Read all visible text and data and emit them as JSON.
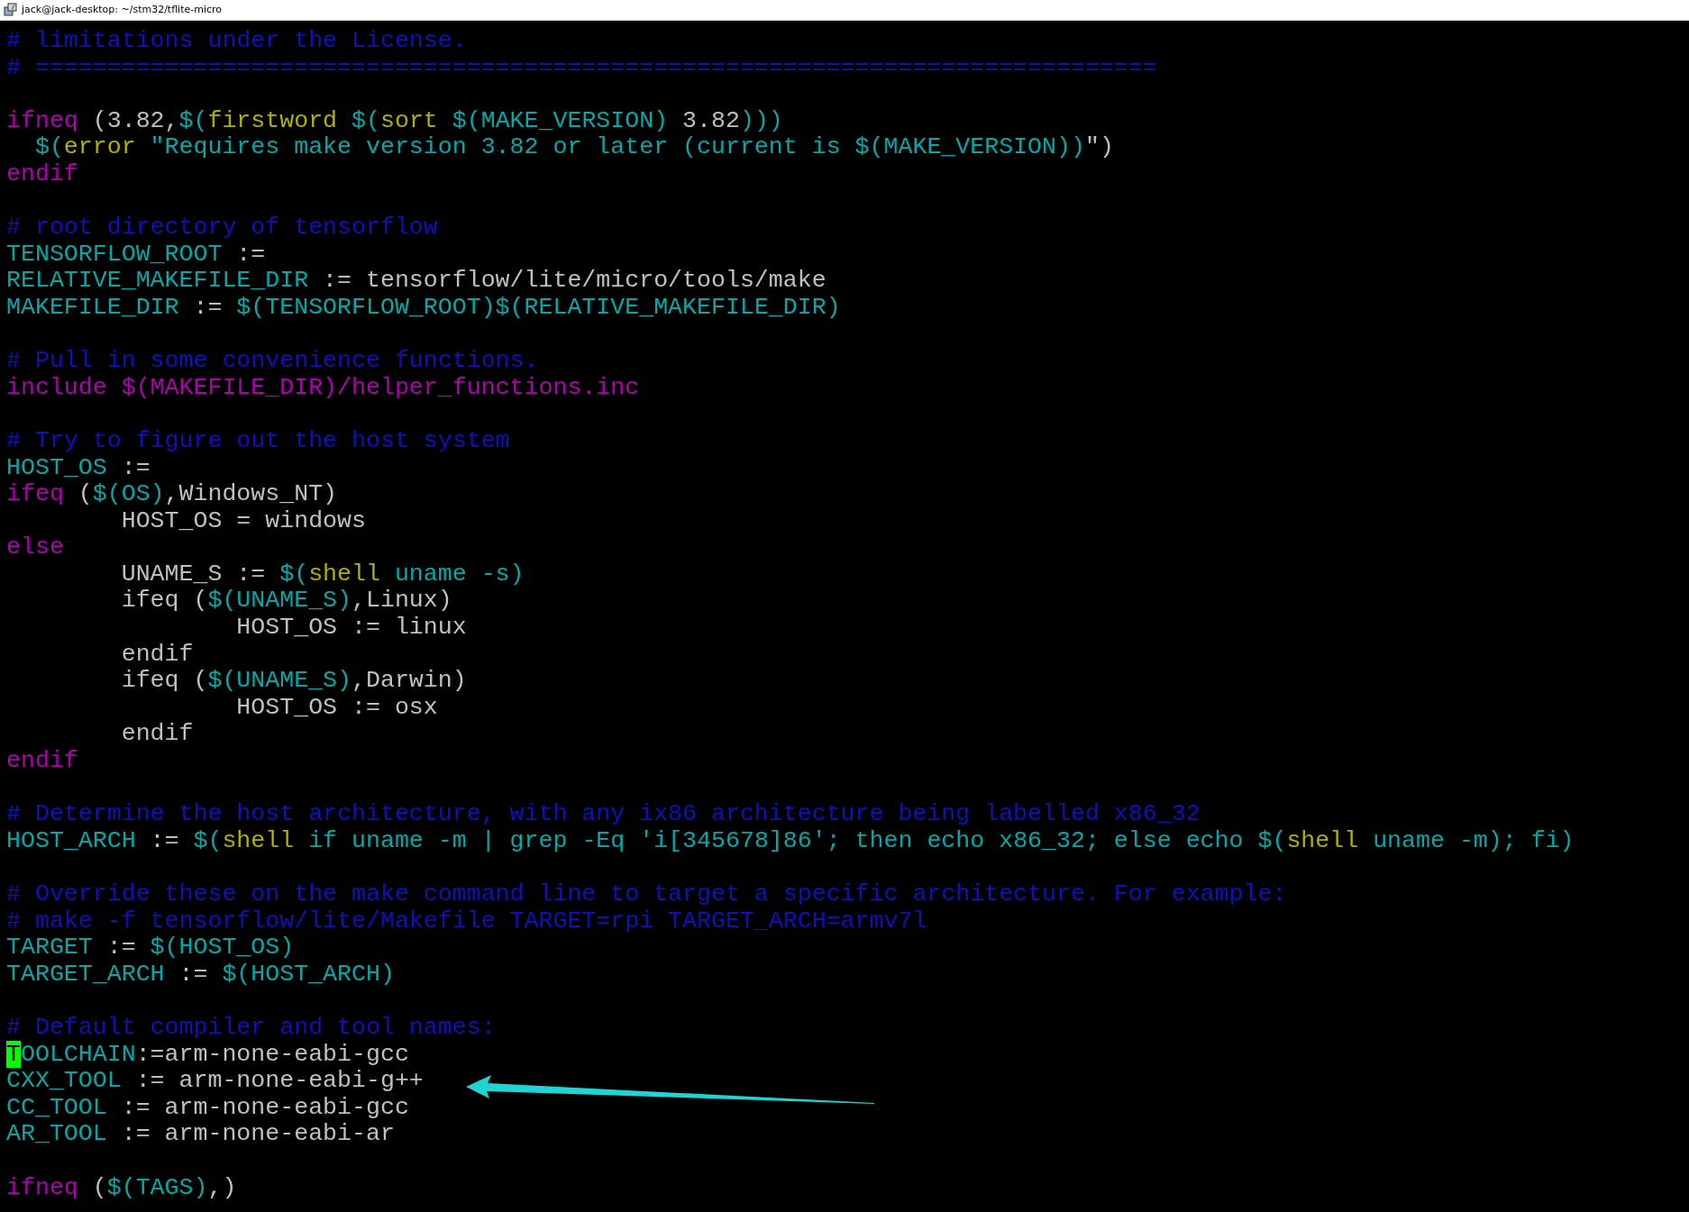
{
  "window": {
    "title": "jack@jack-desktop: ~/stm32/tflite-micro"
  },
  "lines": [
    {
      "kind": "code",
      "segments": [
        {
          "text": "# limitations under the License.",
          "kind": "comment"
        }
      ]
    },
    {
      "kind": "code",
      "segments": [
        {
          "text": "# ==============================================================================",
          "kind": "comment"
        }
      ]
    },
    {
      "kind": "blank"
    },
    {
      "kind": "code",
      "segments": [
        {
          "text": "ifneq",
          "kind": "keyword"
        },
        {
          "text": " (3.82,",
          "kind": "plain"
        },
        {
          "text": "$(",
          "kind": "variable"
        },
        {
          "text": "firstword",
          "kind": "function"
        },
        {
          "text": " $(",
          "kind": "variable"
        },
        {
          "text": "sort",
          "kind": "function"
        },
        {
          "text": " $(MAKE_VERSION)",
          "kind": "variable"
        },
        {
          "text": " 3.82",
          "kind": "plain"
        },
        {
          "text": ")))",
          "kind": "variable"
        }
      ]
    },
    {
      "kind": "code",
      "segments": [
        {
          "text": "  $(",
          "kind": "variable"
        },
        {
          "text": "error",
          "kind": "function"
        },
        {
          "text": " \"Requires make version 3.82 or later (current is $(MAKE_VERSION))",
          "kind": "variable"
        },
        {
          "text": "\")",
          "kind": "plain"
        }
      ]
    },
    {
      "kind": "code",
      "segments": [
        {
          "text": "endif",
          "kind": "keyword"
        }
      ]
    },
    {
      "kind": "blank"
    },
    {
      "kind": "code",
      "segments": [
        {
          "text": "# root directory of tensorflow",
          "kind": "comment"
        }
      ]
    },
    {
      "kind": "code",
      "segments": [
        {
          "text": "TENSORFLOW_ROOT",
          "kind": "variable"
        },
        {
          "text": " :=",
          "kind": "plain"
        }
      ]
    },
    {
      "kind": "code",
      "segments": [
        {
          "text": "RELATIVE_MAKEFILE_DIR",
          "kind": "variable"
        },
        {
          "text": " := tensorflow/lite/micro/tools/make",
          "kind": "plain"
        }
      ]
    },
    {
      "kind": "code",
      "segments": [
        {
          "text": "MAKEFILE_DIR",
          "kind": "variable"
        },
        {
          "text": " := ",
          "kind": "plain"
        },
        {
          "text": "$(TENSORFLOW_ROOT)$(RELATIVE_MAKEFILE_DIR)",
          "kind": "variable"
        }
      ]
    },
    {
      "kind": "blank"
    },
    {
      "kind": "code",
      "segments": [
        {
          "text": "# Pull in some convenience functions.",
          "kind": "comment"
        }
      ]
    },
    {
      "kind": "code",
      "segments": [
        {
          "text": "include $(MAKEFILE_DIR)/helper_functions.inc",
          "kind": "keyword"
        }
      ]
    },
    {
      "kind": "blank"
    },
    {
      "kind": "code",
      "segments": [
        {
          "text": "# Try to figure out the host system",
          "kind": "comment"
        }
      ]
    },
    {
      "kind": "code",
      "segments": [
        {
          "text": "HOST_OS",
          "kind": "variable"
        },
        {
          "text": " :=",
          "kind": "plain"
        }
      ]
    },
    {
      "kind": "code",
      "segments": [
        {
          "text": "ifeq",
          "kind": "keyword"
        },
        {
          "text": " (",
          "kind": "plain"
        },
        {
          "text": "$(OS)",
          "kind": "variable"
        },
        {
          "text": ",Windows_NT)",
          "kind": "plain"
        }
      ]
    },
    {
      "kind": "code",
      "segments": [
        {
          "text": "        HOST_OS = windows",
          "kind": "plain"
        }
      ]
    },
    {
      "kind": "code",
      "segments": [
        {
          "text": "else",
          "kind": "keyword"
        }
      ]
    },
    {
      "kind": "code",
      "segments": [
        {
          "text": "        UNAME_S := ",
          "kind": "plain"
        },
        {
          "text": "$(",
          "kind": "variable"
        },
        {
          "text": "shell",
          "kind": "function"
        },
        {
          "text": " uname -s)",
          "kind": "variable"
        }
      ]
    },
    {
      "kind": "code",
      "segments": [
        {
          "text": "        ifeq (",
          "kind": "plain"
        },
        {
          "text": "$(UNAME_S)",
          "kind": "variable"
        },
        {
          "text": ",Linux)",
          "kind": "plain"
        }
      ]
    },
    {
      "kind": "code",
      "segments": [
        {
          "text": "                HOST_OS := linux",
          "kind": "plain"
        }
      ]
    },
    {
      "kind": "code",
      "segments": [
        {
          "text": "        endif",
          "kind": "plain"
        }
      ]
    },
    {
      "kind": "code",
      "segments": [
        {
          "text": "        ifeq (",
          "kind": "plain"
        },
        {
          "text": "$(UNAME_S)",
          "kind": "variable"
        },
        {
          "text": ",Darwin)",
          "kind": "plain"
        }
      ]
    },
    {
      "kind": "code",
      "segments": [
        {
          "text": "                HOST_OS := osx",
          "kind": "plain"
        }
      ]
    },
    {
      "kind": "code",
      "segments": [
        {
          "text": "        endif",
          "kind": "plain"
        }
      ]
    },
    {
      "kind": "code",
      "segments": [
        {
          "text": "endif",
          "kind": "keyword"
        }
      ]
    },
    {
      "kind": "blank"
    },
    {
      "kind": "code",
      "segments": [
        {
          "text": "# Determine the host architecture, with any ix86 architecture being labelled x86_32",
          "kind": "comment"
        }
      ]
    },
    {
      "kind": "code",
      "segments": [
        {
          "text": "HOST_ARCH",
          "kind": "variable"
        },
        {
          "text": " := ",
          "kind": "plain"
        },
        {
          "text": "$(",
          "kind": "variable"
        },
        {
          "text": "shell",
          "kind": "function"
        },
        {
          "text": " if uname -m | grep -Eq 'i[345678]86'; then echo x86_32; else echo $(",
          "kind": "variable"
        },
        {
          "text": "shell",
          "kind": "function"
        },
        {
          "text": " uname -m); fi)",
          "kind": "variable"
        }
      ]
    },
    {
      "kind": "blank"
    },
    {
      "kind": "code",
      "segments": [
        {
          "text": "# Override these on the make command line to target a specific architecture. For example:",
          "kind": "comment"
        }
      ]
    },
    {
      "kind": "code",
      "segments": [
        {
          "text": "# make -f tensorflow/lite/Makefile TARGET=rpi TARGET_ARCH=armv7l",
          "kind": "comment"
        }
      ]
    },
    {
      "kind": "code",
      "segments": [
        {
          "text": "TARGET",
          "kind": "variable"
        },
        {
          "text": " := ",
          "kind": "plain"
        },
        {
          "text": "$(HOST_OS)",
          "kind": "variable"
        }
      ]
    },
    {
      "kind": "code",
      "segments": [
        {
          "text": "TARGET_ARCH",
          "kind": "variable"
        },
        {
          "text": " := ",
          "kind": "plain"
        },
        {
          "text": "$(HOST_ARCH)",
          "kind": "variable"
        }
      ]
    },
    {
      "kind": "blank"
    },
    {
      "kind": "code",
      "segments": [
        {
          "text": "# Default compiler and tool names:",
          "kind": "comment"
        }
      ]
    },
    {
      "kind": "code",
      "segments": [
        {
          "text": "T",
          "kind": "cursor"
        },
        {
          "text": "OOLCHAIN",
          "kind": "variable"
        },
        {
          "text": ":=arm-none-eabi-gcc",
          "kind": "plain"
        }
      ]
    },
    {
      "kind": "code",
      "segments": [
        {
          "text": "CXX_TOOL",
          "kind": "variable"
        },
        {
          "text": " := arm-none-eabi-g++",
          "kind": "plain"
        }
      ]
    },
    {
      "kind": "code",
      "segments": [
        {
          "text": "CC_TOOL",
          "kind": "variable"
        },
        {
          "text": " := arm-none-eabi-gcc",
          "kind": "plain"
        }
      ]
    },
    {
      "kind": "code",
      "segments": [
        {
          "text": "AR_TOOL",
          "kind": "variable"
        },
        {
          "text": " := arm-none-eabi-ar",
          "kind": "plain"
        }
      ]
    },
    {
      "kind": "blank"
    },
    {
      "kind": "code",
      "segments": [
        {
          "text": "ifneq",
          "kind": "keyword"
        },
        {
          "text": " (",
          "kind": "plain"
        },
        {
          "text": "$(TAGS)",
          "kind": "variable"
        },
        {
          "text": ",)",
          "kind": "plain"
        }
      ]
    }
  ]
}
